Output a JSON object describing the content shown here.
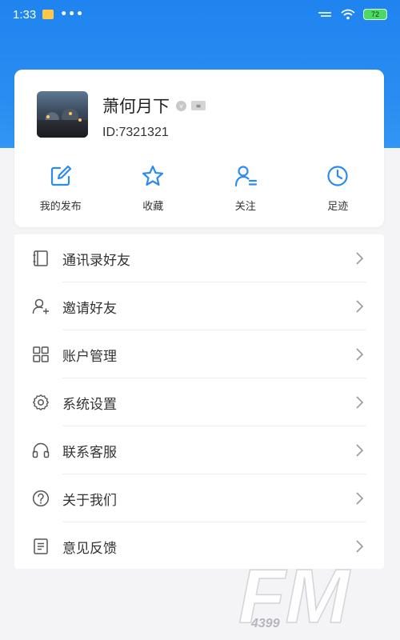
{
  "status_bar": {
    "time": "1:33",
    "dots": "•••",
    "battery_text": "72"
  },
  "profile": {
    "name": "萧何月下",
    "badge_v": "v",
    "badge_level": "≡",
    "id_text": "ID:7321321"
  },
  "shortcuts": [
    {
      "label": "我的发布",
      "icon": "edit-icon"
    },
    {
      "label": "收藏",
      "icon": "star-icon"
    },
    {
      "label": "关注",
      "icon": "user-follow-icon"
    },
    {
      "label": "足迹",
      "icon": "clock-icon"
    }
  ],
  "menu": [
    {
      "label": "通讯录好友",
      "icon": "contacts-icon"
    },
    {
      "label": "邀请好友",
      "icon": "add-user-icon"
    },
    {
      "label": "账户管理",
      "icon": "grid-icon"
    },
    {
      "label": "系统设置",
      "icon": "gear-icon"
    },
    {
      "label": "联系客服",
      "icon": "headset-icon"
    },
    {
      "label": "关于我们",
      "icon": "question-icon"
    },
    {
      "label": "意见反馈",
      "icon": "document-icon"
    }
  ],
  "watermark": {
    "brand": "FM",
    "sub": "4399"
  },
  "colors": {
    "accent": "#2b8cf0",
    "header_gradient_top": "#1f84ef",
    "background": "#f4f4f6"
  }
}
